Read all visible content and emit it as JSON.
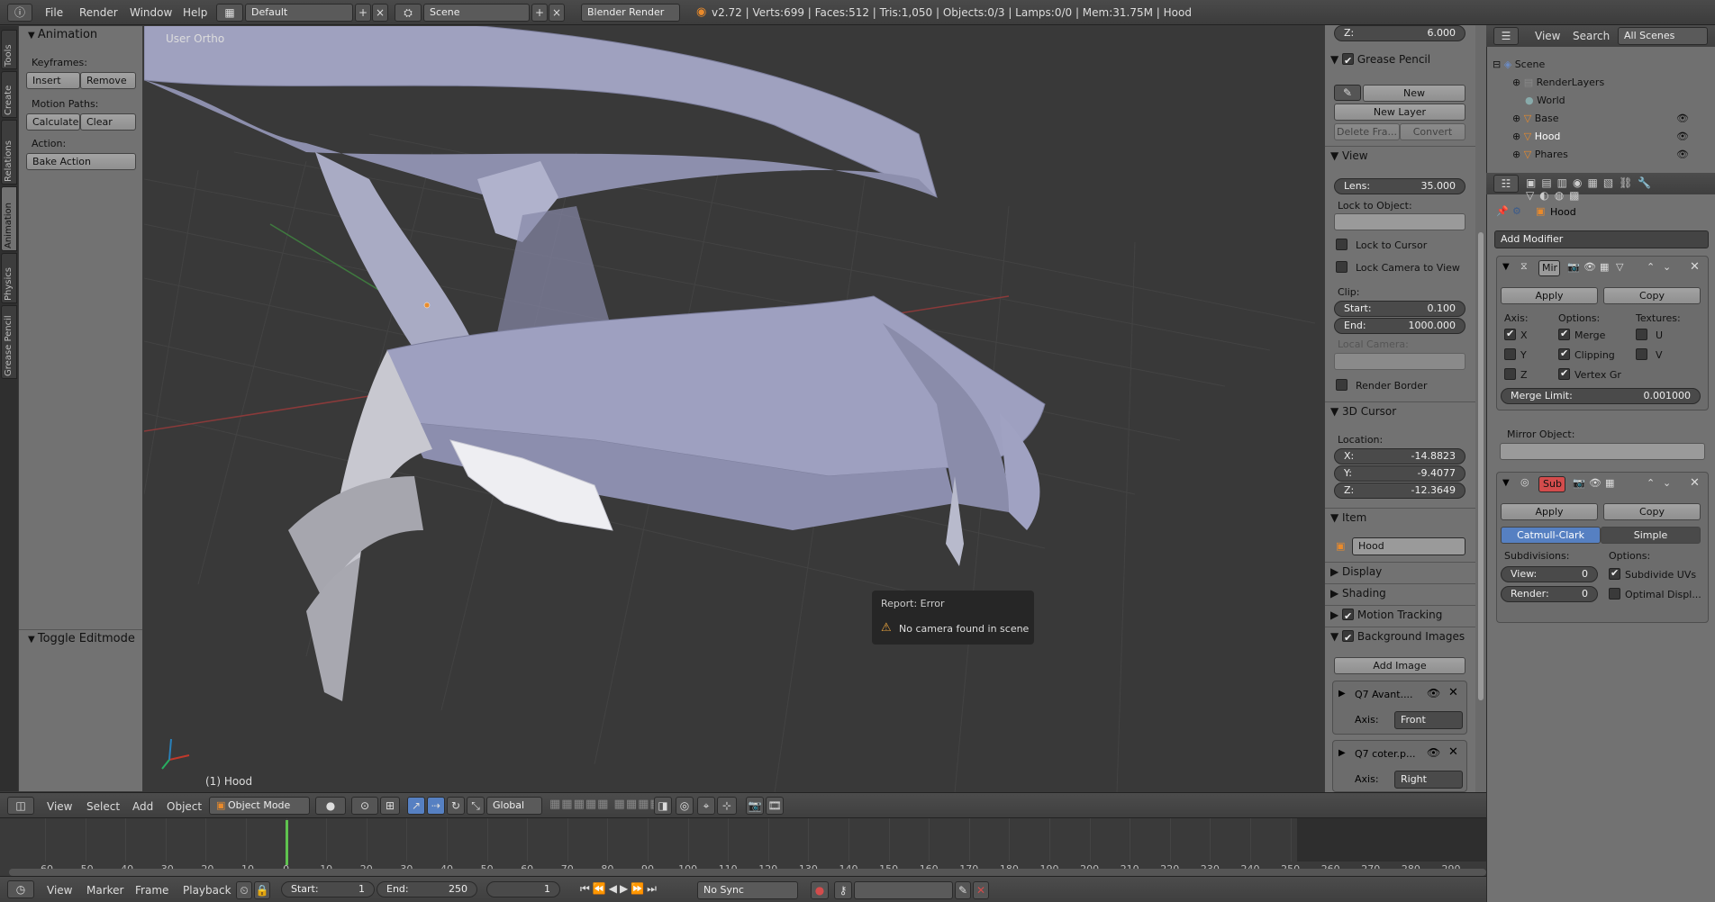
{
  "header": {
    "menus": [
      "File",
      "Render",
      "Window",
      "Help"
    ],
    "layout": "Default",
    "scene": "Scene",
    "engine": "Blender Render",
    "stats": "v2.72 | Verts:699 | Faces:512 | Tris:1,050 | Objects:0/3 | Lamps:0/0 | Mem:31.75M | Hood"
  },
  "tool_tabs": [
    "Tools",
    "Create",
    "Relations",
    "Animation",
    "Physics",
    "Grease Pencil"
  ],
  "shelf": {
    "animation_title": "Animation",
    "keyframes_label": "Keyframes:",
    "insert": "Insert",
    "remove": "Remove",
    "motion_paths_label": "Motion Paths:",
    "calculate": "Calculate",
    "clear": "Clear",
    "action_label": "Action:",
    "bake_action": "Bake Action",
    "toggle_editmode": "Toggle Editmode"
  },
  "viewport": {
    "view_name": "User Ortho",
    "object_label": "(1) Hood"
  },
  "report": {
    "title": "Report: Error",
    "message": "No camera found in scene"
  },
  "npanel": {
    "z_top_label": "Z:",
    "z_top_value": "6.000",
    "grease_pencil": "Grease Pencil",
    "new": "New",
    "new_layer": "New Layer",
    "delete_frame": "Delete Fra...",
    "convert": "Convert",
    "view_title": "View",
    "lens_label": "Lens:",
    "lens_value": "35.000",
    "lock_to_object": "Lock to Object:",
    "lock_to_cursor": "Lock to Cursor",
    "lock_camera": "Lock Camera to View",
    "clip_label": "Clip:",
    "clip_start_label": "Start:",
    "clip_start_value": "0.100",
    "clip_end_label": "End:",
    "clip_end_value": "1000.000",
    "local_camera": "Local Camera:",
    "render_border": "Render Border",
    "cursor_title": "3D Cursor",
    "location_label": "Location:",
    "cx_label": "X:",
    "cx_value": "-14.8823",
    "cy_label": "Y:",
    "cy_value": "-9.4077",
    "cz_label": "Z:",
    "cz_value": "-12.3649",
    "item_title": "Item",
    "item_name": "Hood",
    "display": "Display",
    "shading": "Shading",
    "motion_tracking": "Motion Tracking",
    "background_images": "Background Images",
    "add_image": "Add Image",
    "bg1_name": "Q7 Avant....",
    "bg1_axis_label": "Axis:",
    "bg1_axis": "Front",
    "bg2_name": "Q7 coter.p...",
    "bg2_axis_label": "Axis:",
    "bg2_axis": "Right"
  },
  "outliner": {
    "view": "View",
    "search": "Search",
    "filter": "All Scenes",
    "items": [
      "Scene",
      "RenderLayers",
      "World",
      "Base",
      "Hood",
      "Phares"
    ]
  },
  "properties": {
    "object": "Hood",
    "add_modifier": "Add Modifier",
    "mirror": {
      "name": "Mir",
      "apply": "Apply",
      "copy": "Copy",
      "axis_label": "Axis:",
      "options_label": "Options:",
      "textures_label": "Textures:",
      "x": "X",
      "y": "Y",
      "z": "Z",
      "merge": "Merge",
      "clipping": "Clipping",
      "vertex_groups": "Vertex Gr",
      "u": "U",
      "v": "V",
      "merge_limit_label": "Merge Limit:",
      "merge_limit_value": "0.001000",
      "mirror_object_label": "Mirror Object:"
    },
    "subsurf": {
      "name": "Sub",
      "apply": "Apply",
      "copy": "Copy",
      "catmull": "Catmull-Clark",
      "simple": "Simple",
      "subdivisions_label": "Subdivisions:",
      "options_label": "Options:",
      "view_label": "View:",
      "view_value": "0",
      "render_label": "Render:",
      "render_value": "0",
      "subdivide_uvs": "Subdivide UVs",
      "optimal_display": "Optimal Displ..."
    }
  },
  "view_header": {
    "menus": [
      "View",
      "Select",
      "Add",
      "Object"
    ],
    "mode": "Object Mode",
    "orientation": "Global"
  },
  "timeline": {
    "ticks": [
      "-60",
      "-50",
      "-40",
      "-30",
      "-20",
      "-10",
      "0",
      "10",
      "20",
      "30",
      "40",
      "50",
      "60",
      "70",
      "80",
      "90",
      "100",
      "110",
      "120",
      "130",
      "140",
      "150",
      "160",
      "170",
      "180",
      "190",
      "200",
      "210",
      "220",
      "230",
      "240",
      "250",
      "260",
      "270",
      "280",
      "290"
    ],
    "current_frame_marker": 0,
    "menus": [
      "View",
      "Marker",
      "Frame",
      "Playback"
    ],
    "start_label": "Start:",
    "start_value": "1",
    "end_label": "End:",
    "end_value": "250",
    "current_value": "1",
    "sync": "No Sync"
  },
  "colors": {
    "accent": "#5680c2",
    "error_red": "#d34c4c",
    "frame_line": "#5fc24f",
    "mesh": "#9ea0c0"
  }
}
